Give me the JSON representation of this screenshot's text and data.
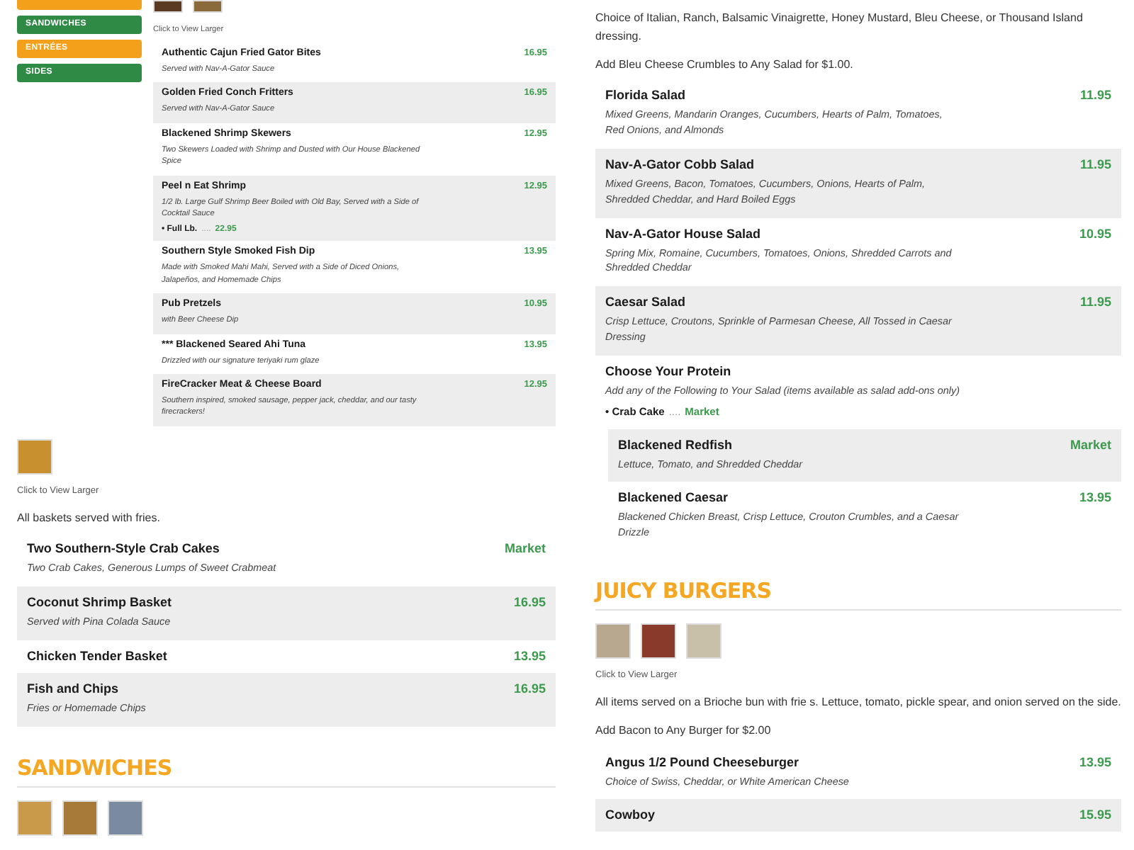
{
  "nav": [
    {
      "color": "#f5a01b"
    },
    {
      "label": "SANDWICHES",
      "color": "#2f8a46"
    },
    {
      "label": "ENTRÉES",
      "color": "#f5a01b"
    },
    {
      "label": "SIDES",
      "color": "#2f8a46"
    }
  ],
  "left_column": {
    "sections": [
      {
        "photos": [
          {
            "color": "#5a3a22"
          },
          {
            "color": "#8a6a3a"
          }
        ],
        "caption": "Click to View Larger",
        "items": [
          {
            "name": "Authentic Cajun Fried Gator Bites",
            "price": "16.95",
            "description": "Served with Nav-A-Gator Sauce",
            "shaded": false
          },
          {
            "name": "Golden Fried Conch Fritters",
            "price": "16.95",
            "description": "Served with Nav-A-Gator Sauce",
            "shaded": true
          },
          {
            "name": "Blackened Shrimp Skewers",
            "price": "12.95",
            "description": "Two Skewers Loaded with Shrimp and Dusted with Our House Blackened Spice",
            "shaded": false
          },
          {
            "name": "Peel n Eat Shrimp",
            "price": "12.95",
            "description": "1/2 lb. Large Gulf Shrimp Beer Boiled with Old Bay, Served with a Side of Cocktail Sauce",
            "extras": [
              {
                "label": "• Full Lb.",
                "leader": "....",
                "price": "22.95"
              }
            ],
            "shaded": true
          },
          {
            "name": "Southern Style Smoked Fish Dip",
            "price": "13.95",
            "description": "Made with Smoked Mahi Mahi, Served with a Side of Diced Onions, Jalapeños, and Homemade Chips",
            "shaded": false
          },
          {
            "name": "Pub Pretzels",
            "price": "10.95",
            "description": "with Beer Cheese Dip",
            "shaded": true
          },
          {
            "name": "*** Blackened Seared Ahi Tuna",
            "price": "13.95",
            "description": "Drizzled with our signature teriyaki rum glaze",
            "shaded": false
          },
          {
            "name": "FireCracker Meat & Cheese Board",
            "price": "12.95",
            "description": "Southern inspired, smoked sausage, pepper jack, cheddar, and our tasty firecrackers!",
            "shaded": true
          }
        ]
      },
      {
        "photos": [
          {
            "color": "#c8902e"
          }
        ],
        "caption": "Click to View Larger",
        "notes": [
          "All baskets served with fries."
        ],
        "items": [
          {
            "name": "Two Southern-Style Crab Cakes",
            "price": "Market",
            "description": "Two Crab Cakes, Generous Lumps of Sweet Crabmeat",
            "shaded": false
          },
          {
            "name": "Coconut Shrimp Basket",
            "price": "16.95",
            "description": "Served with Pina Colada Sauce",
            "shaded": true
          },
          {
            "name": "Chicken Tender Basket",
            "price": "13.95",
            "shaded": false
          },
          {
            "name": "Fish and Chips",
            "price": "16.95",
            "description": "Fries or Homemade Chips",
            "shaded": true
          }
        ]
      },
      {
        "heading": "SANDWICHES",
        "photos": [
          {
            "color": "#c89a4a"
          },
          {
            "color": "#a87a3a"
          },
          {
            "color": "#7a8aa0"
          }
        ]
      }
    ]
  },
  "right_column": {
    "sections": [
      {
        "notes": [
          "Choice of Italian, Ranch, Balsamic Vinaigrette, Honey Mustard, Bleu Cheese, or Thousand Island dressing.",
          "Add Bleu Cheese Crumbles to Any Salad for $1.00."
        ],
        "items": [
          {
            "name": "Florida Salad",
            "price": "11.95",
            "description": "Mixed Greens, Mandarin Oranges, Cucumbers, Hearts of Palm, Tomatoes, Red Onions, and Almonds",
            "shaded": false
          },
          {
            "name": "Nav-A-Gator Cobb Salad",
            "price": "11.95",
            "description": "Mixed Greens, Bacon, Tomatoes, Cucumbers, Onions, Hearts of Palm, Shredded Cheddar, and Hard Boiled Eggs",
            "shaded": true
          },
          {
            "name": "Nav-A-Gator House Salad",
            "price": "10.95",
            "description": "Spring Mix, Romaine, Cucumbers, Tomatoes, Onions, Shredded Carrots and Shredded Cheddar",
            "shaded": false
          },
          {
            "name": "Caesar Salad",
            "price": "11.95",
            "description": "Crisp Lettuce, Croutons, Sprinkle of Parmesan Cheese, All Tossed in Caesar Dressing",
            "shaded": true
          },
          {
            "name": "Choose Your Protein",
            "description": "Add any of the Following to Your Salad (items available as salad add-ons only)",
            "extras": [
              {
                "label": "• Crab Cake",
                "leader": "....",
                "price": "Market"
              }
            ],
            "shaded": false,
            "children": [
              {
                "name": "Blackened Redfish",
                "price": "Market",
                "description": "Lettuce, Tomato, and Shredded Cheddar",
                "shaded": true
              },
              {
                "name": "Blackened Caesar",
                "price": "13.95",
                "description": "Blackened Chicken Breast, Crisp Lettuce, Crouton Crumbles, and a Caesar Drizzle",
                "shaded": false
              }
            ]
          }
        ]
      },
      {
        "heading": "JUICY BURGERS",
        "photos": [
          {
            "color": "#b8a890"
          },
          {
            "color": "#8a3a2a"
          },
          {
            "color": "#c8c0a8"
          }
        ],
        "caption": "Click to View Larger",
        "notes": [
          "All items served on a Brioche bun with frie s. Lettuce, tomato, pickle spear, and onion served on the side.",
          "Add Bacon to Any Burger for $2.00"
        ],
        "items": [
          {
            "name": "Angus 1/2 Pound Cheeseburger",
            "price": "13.95",
            "description": "Choice of Swiss, Cheddar, or White American Cheese",
            "shaded": false
          },
          {
            "name": "Cowboy",
            "price": "15.95",
            "shaded": true
          }
        ]
      }
    ]
  }
}
